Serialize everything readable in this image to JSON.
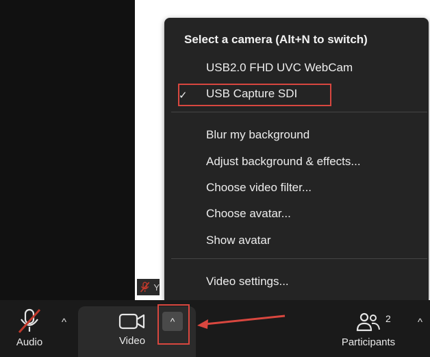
{
  "camera_menu": {
    "title": "Select a camera (Alt+N to switch)",
    "cameras": [
      {
        "label": "USB2.0 FHD UVC WebCam",
        "selected": false
      },
      {
        "label": "USB Capture SDI",
        "selected": true
      }
    ],
    "check_mark": "✓",
    "effects": [
      "Blur my background",
      "Adjust background & effects...",
      "Choose video filter...",
      "Choose avatar...",
      "Show avatar"
    ],
    "settings": "Video settings..."
  },
  "participant_badge": {
    "text": "Y"
  },
  "toolbar": {
    "audio_label": "Audio",
    "video_label": "Video",
    "participants_label": "Participants",
    "participants_count": "2",
    "caret_up": "^"
  },
  "colors": {
    "menu_bg": "#242424",
    "toolbar_bg": "#1a1a1a",
    "highlight": "#d9473f",
    "muted_red": "#c0392b"
  },
  "icons": [
    "mic-muted-icon",
    "video-camera-icon",
    "participants-icon",
    "chevron-up-icon",
    "checkmark-icon",
    "arrow-annotation"
  ]
}
